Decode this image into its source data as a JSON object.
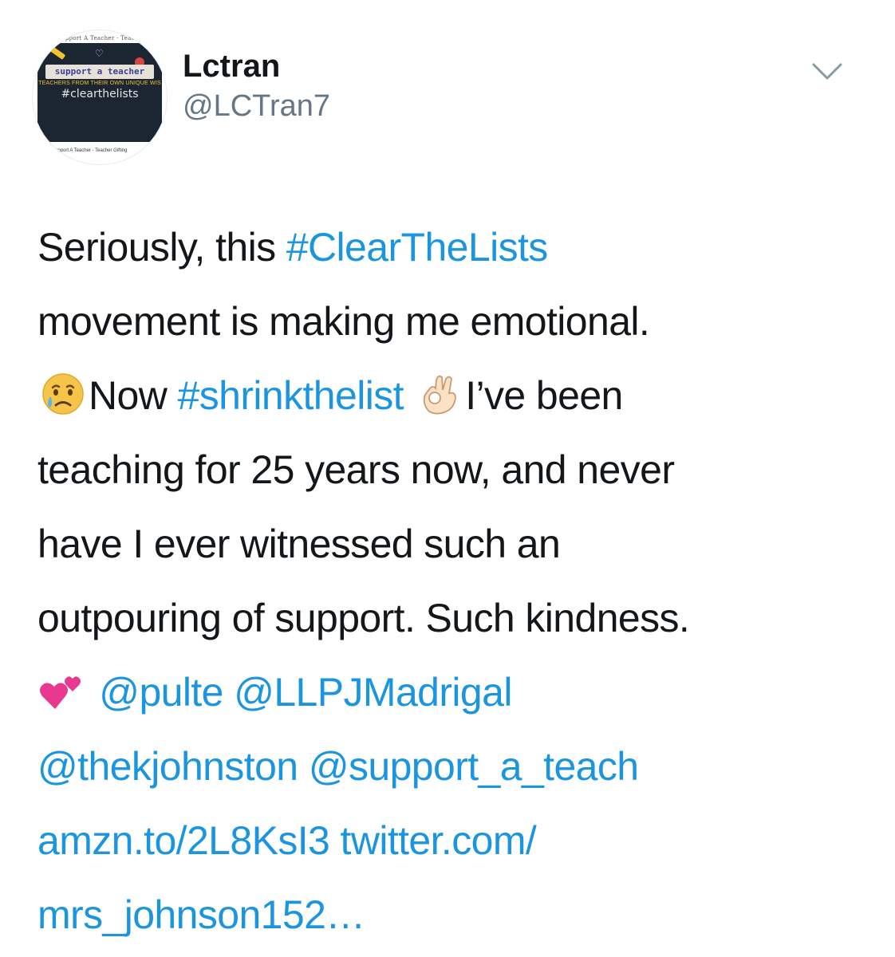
{
  "user": {
    "display_name": "Lctran",
    "handle": "@LCTran7",
    "avatar": {
      "top_text": "Support A Teacher - Teache",
      "title": "support a teacher",
      "subtitle": "TEACHERS FROM THEIR OWN UNIQUE WIS",
      "hashtag": "#clearthelists",
      "bottom_text": "Support A Teacher - Teacher Gifting"
    }
  },
  "menu": {
    "icon": "chevron-down-icon"
  },
  "tweet": {
    "line1_text": "Seriously, this ",
    "hashtag_clearthelists": "#ClearTheLists",
    "line2_text": "movement is making me emotional.",
    "emoji_crying": "crying-face-emoji",
    "line3_now": "Now ",
    "hashtag_shrinkthelist": "#shrinkthelist",
    "emoji_ok_hand": "ok-hand-emoji",
    "line3_end": "I’ve been",
    "line4_text": "teaching for 25 years now, and never",
    "line5_text": "have I ever witnessed such an",
    "line6_text": "outpouring of support. Such kindness.",
    "emoji_hearts": "two-hearts-emoji",
    "mention_pulte": "@pulte",
    "mention_llpjmadrigal": "@LLPJMadrigal",
    "mention_thekjohnston": "@thekjohnston",
    "mention_support_a_teach": "@support_a_teach",
    "link_amzn": "amzn.to/2L8KsI3",
    "link_twitter": "twitter.com/",
    "link_twitter_cont": "mrs_johnson152…"
  },
  "colors": {
    "text": "#14171a",
    "secondary": "#657786",
    "link": "#1b95e0"
  }
}
